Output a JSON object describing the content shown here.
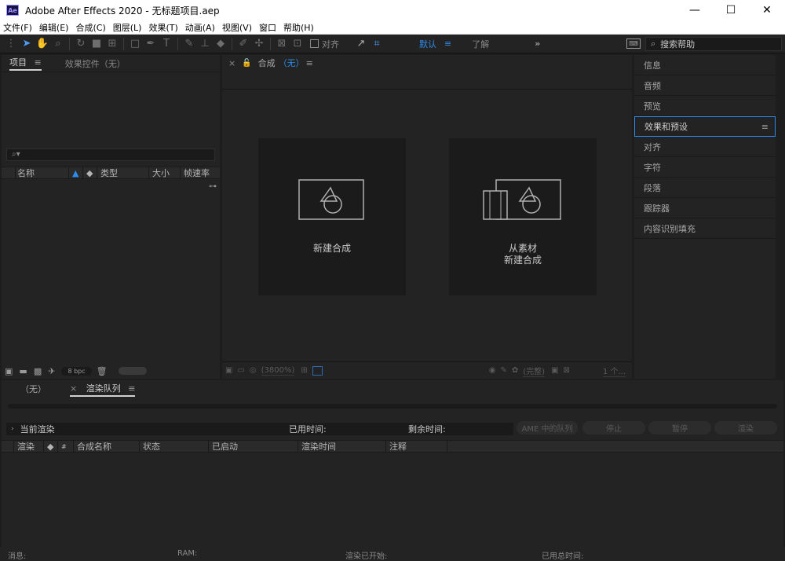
{
  "window": {
    "app_icon_text": "Ae",
    "title": "Adobe After Effects 2020 - 无标题项目.aep",
    "min": "—",
    "max": "☐",
    "close": "✕"
  },
  "menu": [
    "文件(F)",
    "编辑(E)",
    "合成(C)",
    "图层(L)",
    "效果(T)",
    "动画(A)",
    "视图(V)",
    "窗口",
    "帮助(H)"
  ],
  "toolbar": {
    "align_label": "对齐",
    "workspace_default": "默认",
    "workspace_menu": "≡",
    "workspace_learn": "了解",
    "more": "»",
    "search_placeholder": "搜索帮助",
    "kb_icon": "⌨"
  },
  "project_panel": {
    "tabs": [
      "项目",
      "效果控件（无）"
    ],
    "search_icon": "⌕▾",
    "columns": [
      "名称",
      "类型",
      "大小",
      "帧速率"
    ],
    "bpc": "8 bpc"
  },
  "comp_panel": {
    "tab_label": "合成",
    "tab_sub": "（无）",
    "cards": [
      {
        "label_line1": "新建合成",
        "label_line2": ""
      },
      {
        "label_line1": "从素材",
        "label_line2": "新建合成"
      }
    ],
    "zoom": "(3800%)",
    "quality": "(完整)",
    "views": "1 个..."
  },
  "right_panel": {
    "items": [
      "信息",
      "音频",
      "预览",
      "效果和预设",
      "对齐",
      "字符",
      "段落",
      "跟踪器",
      "内容识别填充"
    ]
  },
  "render_panel": {
    "tabs": [
      "（无）",
      "渲染队列"
    ],
    "current_render": "当前渲染",
    "elapsed": "已用时间:",
    "remaining": "剩余时间:",
    "buttons": [
      "AME 中的队列",
      "停止",
      "暂停",
      "渲染"
    ],
    "columns": [
      "渲染",
      "#",
      "合成名称",
      "状态",
      "已启动",
      "渲染时间",
      "注释"
    ]
  },
  "status_bar": {
    "message": "消息:",
    "ram": "RAM:",
    "render_started": "渲染已开始:",
    "total_elapsed": "已用总时间:"
  }
}
